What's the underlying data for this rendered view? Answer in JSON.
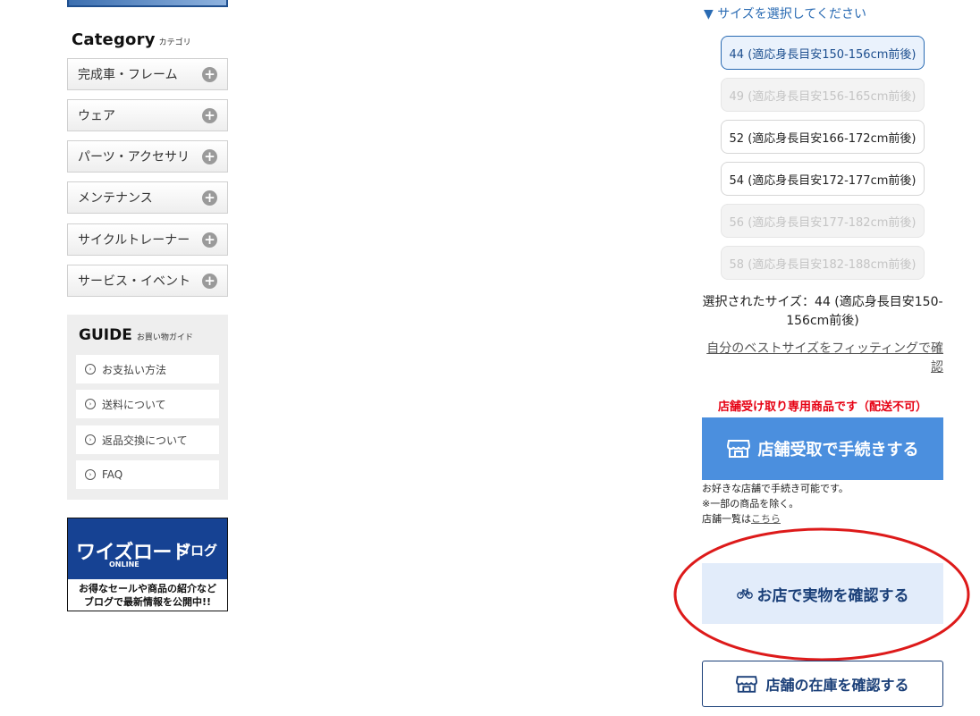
{
  "category": {
    "heading_en": "Category",
    "heading_ja": "カテゴリ",
    "items": [
      {
        "label": "完成車・フレーム"
      },
      {
        "label": "ウェア"
      },
      {
        "label": "パーツ・アクセサリ"
      },
      {
        "label": "メンテナンス"
      },
      {
        "label": "サイクルトレーナー"
      },
      {
        "label": "サービス・イベント"
      }
    ],
    "expand_glyph": "+"
  },
  "guide": {
    "heading_en": "GUIDE",
    "heading_ja": "お買い物ガイド",
    "items": [
      {
        "label": "お支払い方法"
      },
      {
        "label": "送料について"
      },
      {
        "label": "返品交換について"
      },
      {
        "label": "FAQ"
      }
    ]
  },
  "blog_banner": {
    "logo": "ワイズロード",
    "logo_suffix": "ブログ",
    "sub": "ONLINE",
    "line1": "お得なセールや商品の紹介など",
    "line2": "ブログで最新情報を公開中!!"
  },
  "size_selector": {
    "heading": "▼ サイズを選択してください",
    "options": [
      {
        "label": "44 (適応身長目安150-156cm前後)",
        "state": "selected"
      },
      {
        "label": "49 (適応身長目安156-165cm前後)",
        "state": "disabled"
      },
      {
        "label": "52 (適応身長目安166-172cm前後)",
        "state": "available"
      },
      {
        "label": "54 (適応身長目安172-177cm前後)",
        "state": "available"
      },
      {
        "label": "56 (適応身長目安177-182cm前後)",
        "state": "disabled"
      },
      {
        "label": "58 (適応身長目安182-188cm前後)",
        "state": "disabled"
      }
    ],
    "selected_line1": "選択されたサイズ：44 (適応身長目安150-",
    "selected_line2": "156cm前後)",
    "fitting_link_line1": "自分のベストサイズをフィッティングで確",
    "fitting_link_line2": "認"
  },
  "pickup": {
    "notice": "店舗受け取り専用商品です（配送不可）",
    "button_label": "店舗受取で手続きする",
    "note_line1": "お好きな店舗で手続き可能です。",
    "note_line2": "※一部の商品を除く。",
    "note_line3_prefix": "店舗一覧は",
    "note_link": "こちら"
  },
  "check_real_button": {
    "label": "お店で実物を確認する"
  },
  "stock_button": {
    "label": "店舗の在庫を確認する"
  },
  "colors": {
    "accent_blue": "#4b8fde",
    "navy": "#1a3f78",
    "link_blue": "#2a6bb3",
    "alert_red": "#e60012",
    "annotation_red": "#dd1a1a"
  },
  "icons": {
    "store": "store-icon",
    "bicycle": "bicycle-icon",
    "plus": "plus-icon",
    "circle_arrow": "circle-arrow-icon"
  }
}
